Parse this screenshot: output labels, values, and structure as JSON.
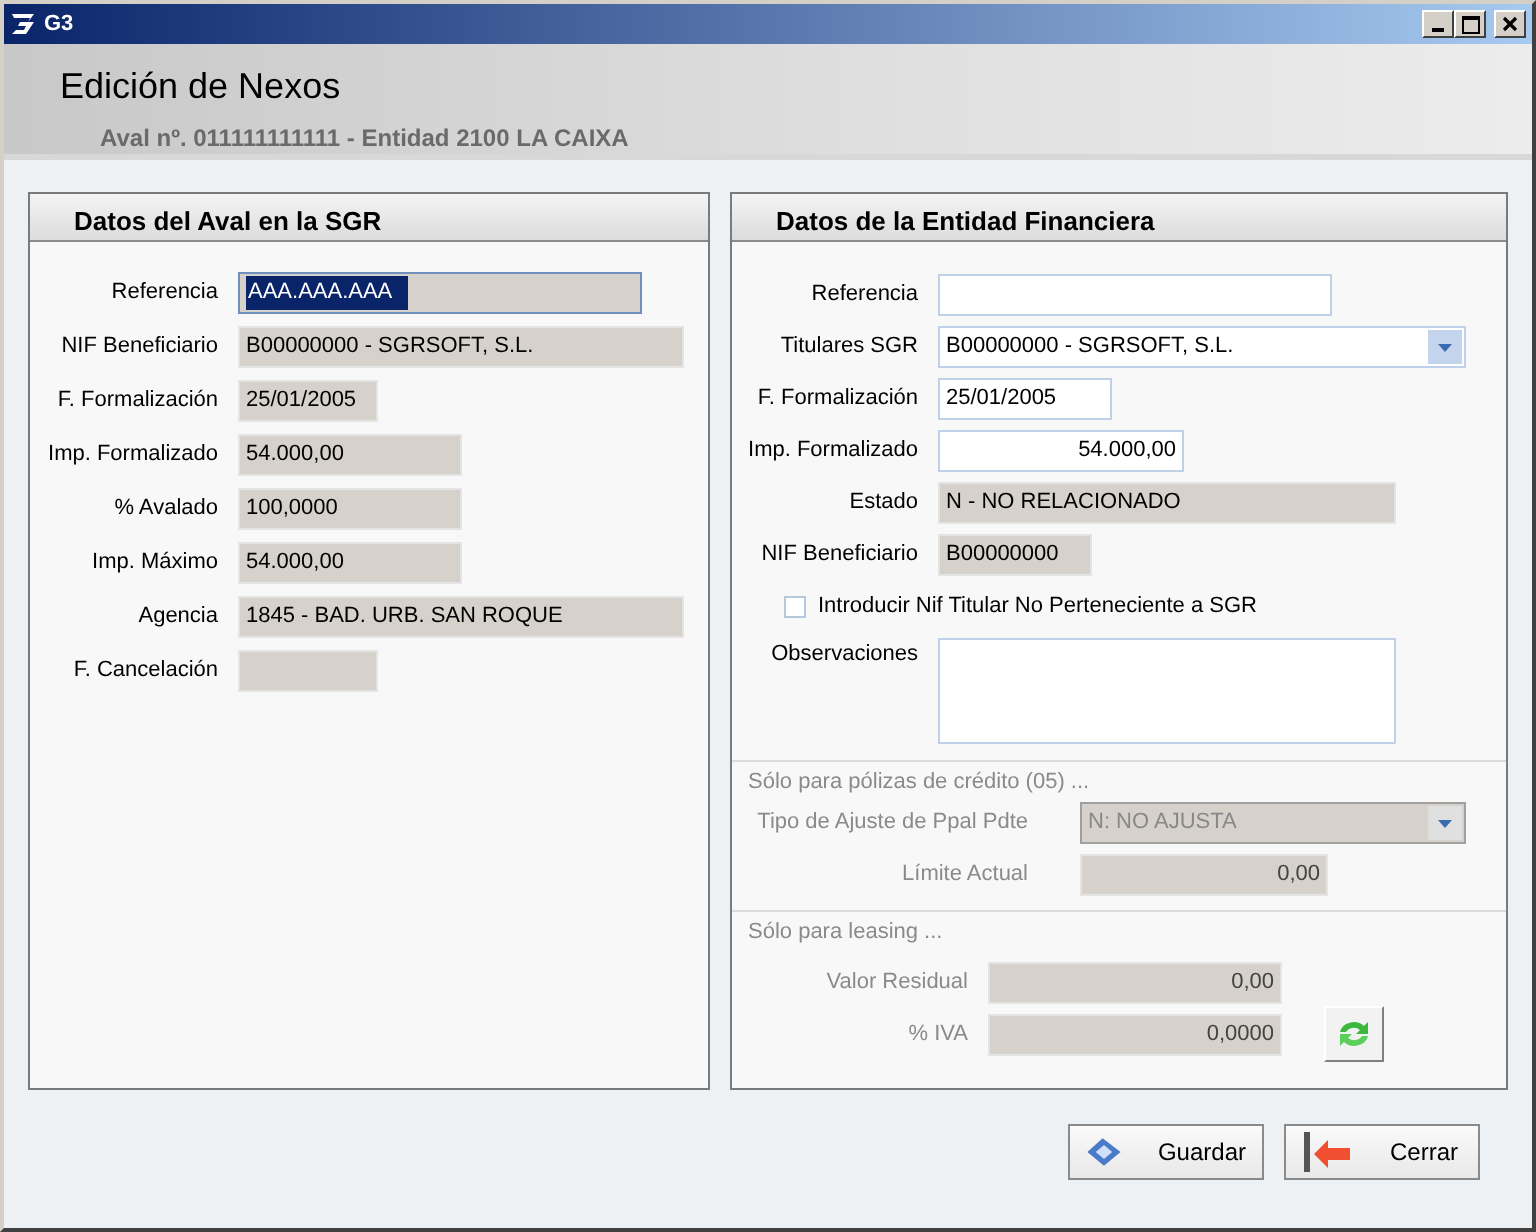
{
  "window": {
    "title": "G3"
  },
  "header": {
    "title": "Edición de Nexos",
    "subtitle": "Aval nº. 011111111111 - Entidad 2100 LA CAIXA"
  },
  "left_panel": {
    "title": "Datos del Aval en la SGR",
    "fields": [
      {
        "label": "Referencia",
        "value": "AAA.AAA.AAA",
        "kind": "reference",
        "readonly": true,
        "highlighted": true
      },
      {
        "label": "NIF Beneficiario",
        "value": "B00000000 - SGRSOFT, S.L.",
        "kind": "text",
        "readonly": true
      },
      {
        "label": "F. Formalización",
        "value": "25/01/2005",
        "kind": "date",
        "readonly": true
      },
      {
        "label": "Imp. Formalizado",
        "value": "54.000,00",
        "kind": "amount",
        "readonly": true
      },
      {
        "label": "% Avalado",
        "value": "100,0000",
        "kind": "amount",
        "readonly": true
      },
      {
        "label": "Imp. Máximo",
        "value": "54.000,00",
        "kind": "amount",
        "readonly": true
      },
      {
        "label": "Agencia",
        "value": "1845 - BAD. URB. SAN ROQUE",
        "kind": "text",
        "readonly": true
      },
      {
        "label": "F. Cancelación",
        "kind": "date",
        "readonly": true
      }
    ]
  },
  "right_panel": {
    "title": "Datos de la Entidad Financiera",
    "fields": [
      {
        "label": "Referencia",
        "kind": "reference"
      },
      {
        "label": "Titulares SGR",
        "value": "B00000000 - SGRSOFT, S.L.",
        "kind": "select"
      },
      {
        "label": "F. Formalización",
        "value": "25/01/2005",
        "kind": "date"
      },
      {
        "label": "Imp. Formalizado",
        "value": "54.000,00",
        "kind": "amount"
      },
      {
        "label": "Estado",
        "value": "N - NO RELACIONADO",
        "kind": "text",
        "readonly": true
      },
      {
        "label": "NIF Beneficiario",
        "value": "B00000000",
        "kind": "nif",
        "readonly": true
      },
      {
        "label": "Introducir Nif Titular No Perteneciente a SGR",
        "kind": "checkbox",
        "checked": false
      },
      {
        "label": "Observaciones",
        "kind": "textarea"
      }
    ],
    "sections": [
      {
        "heading": "Sólo para pólizas de crédito (05) ...",
        "disabled": true,
        "fields": [
          {
            "label": "Tipo de Ajuste de Ppal Pdte",
            "value": "N: NO AJUSTA",
            "kind": "select"
          },
          {
            "label": "Límite Actual",
            "value": "0,00",
            "kind": "amount"
          }
        ]
      },
      {
        "heading": "Sólo para leasing ...",
        "disabled": true,
        "fields": [
          {
            "label": "Valor Residual",
            "value": "0,00",
            "kind": "amount"
          },
          {
            "label": "% IVA",
            "value": "0,0000",
            "kind": "amount"
          }
        ]
      }
    ]
  },
  "buttons": [
    {
      "label": "Guardar",
      "kind": "save"
    },
    {
      "label": "Cerrar",
      "kind": "close"
    }
  ]
}
